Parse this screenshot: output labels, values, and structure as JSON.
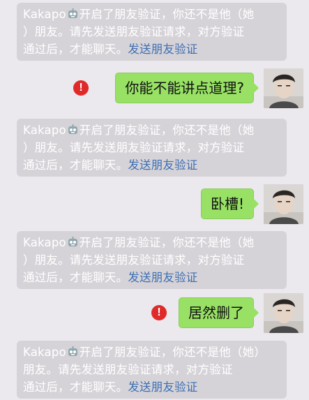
{
  "system_notice": {
    "name": "Kakapo",
    "line1_rest": "开启了朋友验证，你还不是他（她",
    "line2": "）朋友。请先发送朋友验证请求，对方验证",
    "line3": "通过后，才能聊天。",
    "link": "发送朋友验证"
  },
  "system_notice_wrapped": {
    "line1_rest": "开启了朋友验证，你还不是他（她）",
    "line2": "朋友。请先发送朋友验证请求，对方验证",
    "line3": "通过后，才能聊天。"
  },
  "messages": [
    {
      "text": "你能不能讲点道理?",
      "status": "!"
    },
    {
      "text": "卧槽!",
      "status": "!"
    },
    {
      "text": "居然删了",
      "status": "!"
    }
  ],
  "colors": {
    "background": "#ebe8ee",
    "notice_bg": "#d6d3d8",
    "bubble_green": "#98e165",
    "error_red": "#e02a2a",
    "link_blue": "#3d6fb2"
  },
  "icons": {
    "robot": "robot-emoji-icon",
    "error": "send-failed-icon",
    "avatar": "user-avatar"
  }
}
